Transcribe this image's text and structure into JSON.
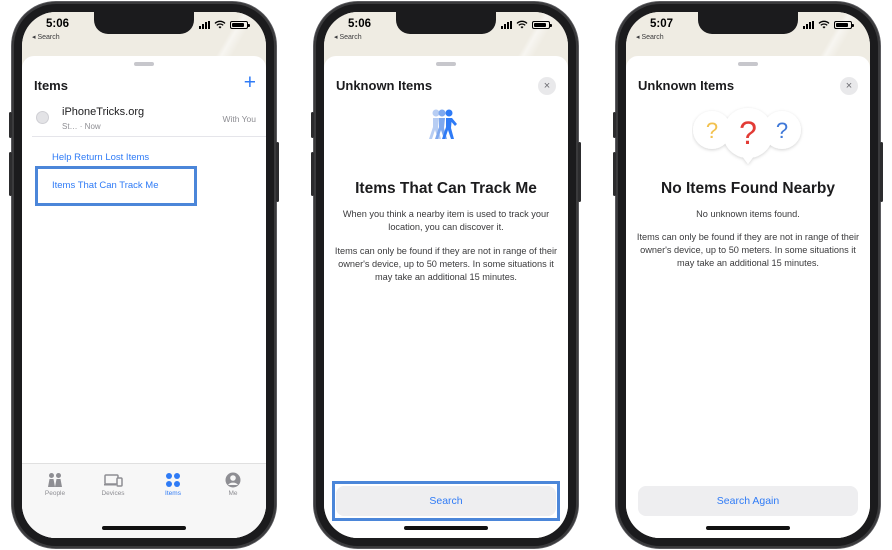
{
  "phones": [
    {
      "status": {
        "time": "5:06",
        "back": "◂ Search"
      },
      "sheet": {
        "title": "Items",
        "item": {
          "name": "iPhoneTricks.org",
          "subtitle": "St…  · Now",
          "owner": "With You"
        },
        "links": [
          "Help Return Lost Items",
          "Items That Can Track Me"
        ]
      },
      "tabs": [
        "People",
        "Devices",
        "Items",
        "Me"
      ],
      "active_tab": "Items"
    },
    {
      "status": {
        "time": "5:06",
        "back": "◂ Search"
      },
      "sheet": {
        "title": "Unknown Items",
        "heading": "Items That Can Track Me",
        "para1": "When you think a nearby item is used to track your location, you can discover it.",
        "para2": "Items can only be found if they are not in range of their owner's device, up to 50 meters. In some situations it may take an additional 15 minutes.",
        "button": "Search"
      }
    },
    {
      "status": {
        "time": "5:07",
        "back": "◂ Search"
      },
      "sheet": {
        "title": "Unknown Items",
        "heading": "No Items Found Nearby",
        "para1": "No unknown items found.",
        "para2": "Items can only be found if they are not in range of their owner's device, up to 50 meters. In some situations it may take an additional 15 minutes.",
        "button": "Search Again"
      }
    }
  ],
  "colors": {
    "accent": "#2f7bf6",
    "highlight": "#4b86d9",
    "question_yellow": "#f2c14e",
    "question_red": "#e23b35",
    "question_blue": "#3f78d8"
  },
  "icons": {
    "close": "×",
    "plus": "+"
  }
}
